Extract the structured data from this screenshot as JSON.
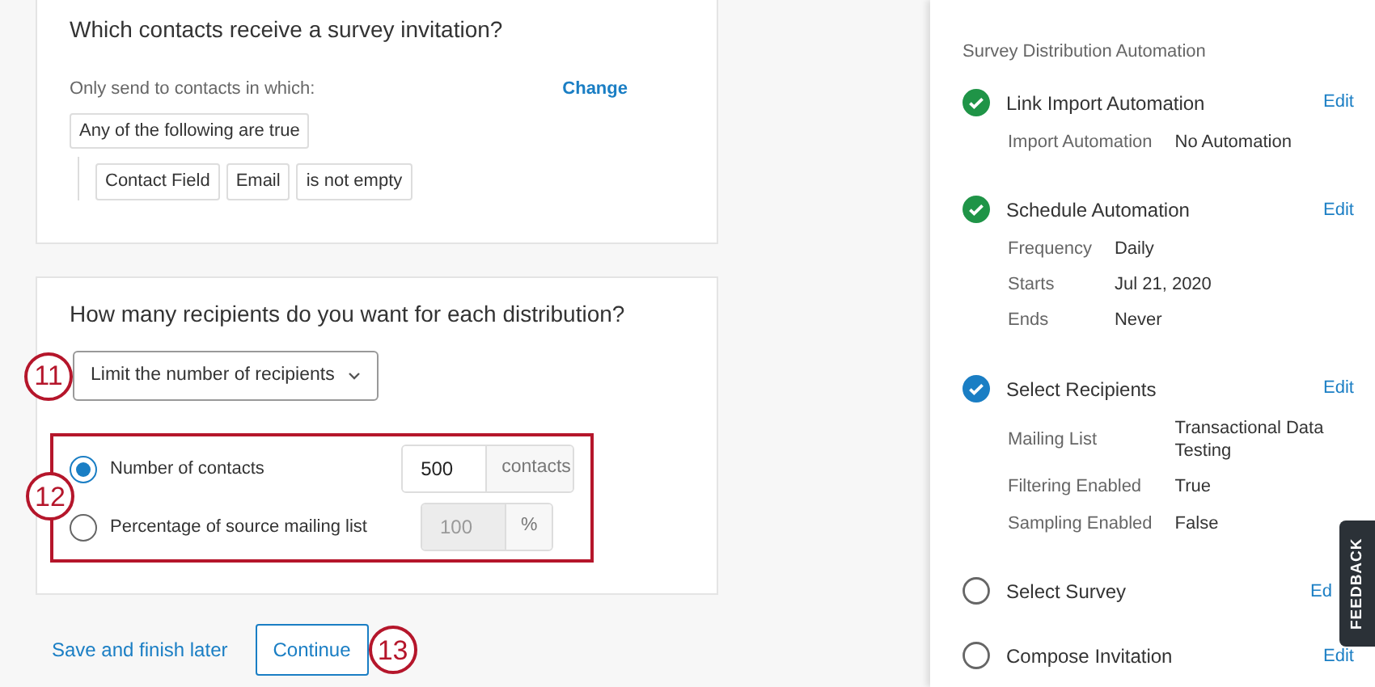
{
  "contacts_card": {
    "title": "Which contacts receive a survey invitation?",
    "filter_label": "Only send to contacts in which:",
    "change_link": "Change",
    "condition_group": "Any of the following are true",
    "condition": [
      "Contact Field",
      "Email",
      "is not empty"
    ]
  },
  "recipients_card": {
    "title": "How many recipients do you want for each distribution?",
    "limit_dropdown": "Limit the number of recipients",
    "dropdown_annotation": "11",
    "options_annotation": "12",
    "options": [
      {
        "label": "Number of contacts",
        "selected": true,
        "value": "500",
        "unit": "contacts",
        "disabled": false
      },
      {
        "label": "Percentage of source mailing list",
        "selected": false,
        "value": "100",
        "unit": "%",
        "disabled": true
      }
    ]
  },
  "footer": {
    "save_link": "Save and finish later",
    "continue_button": "Continue",
    "continue_annotation": "13"
  },
  "sidebar": {
    "heading": "Survey Distribution Automation",
    "feedback_tab": "FEEDBACK",
    "steps": [
      {
        "title": "Link Import Automation",
        "checked": true,
        "selected": false,
        "edit": "Edit",
        "details": [
          {
            "label": "Import Automation",
            "value": "No Automation"
          }
        ]
      },
      {
        "title": "Schedule Automation",
        "checked": true,
        "selected": false,
        "edit": "Edit",
        "details": [
          {
            "label": "Frequency",
            "value": "Daily"
          },
          {
            "label": "Starts",
            "value": "Jul 21, 2020"
          },
          {
            "label": "Ends",
            "value": "Never"
          }
        ]
      },
      {
        "title": "Select Recipients",
        "checked": true,
        "selected": true,
        "edit": "Edit",
        "details": [
          {
            "label": "Mailing List",
            "value": "Transactional Data Testing"
          },
          {
            "label": "Filtering Enabled",
            "value": "True"
          },
          {
            "label": "Sampling Enabled",
            "value": "False"
          }
        ]
      },
      {
        "title": "Select Survey",
        "checked": false,
        "selected": false,
        "edit": "Ed"
      },
      {
        "title": "Compose Invitation",
        "checked": false,
        "selected": false,
        "edit": "Edit"
      }
    ]
  }
}
